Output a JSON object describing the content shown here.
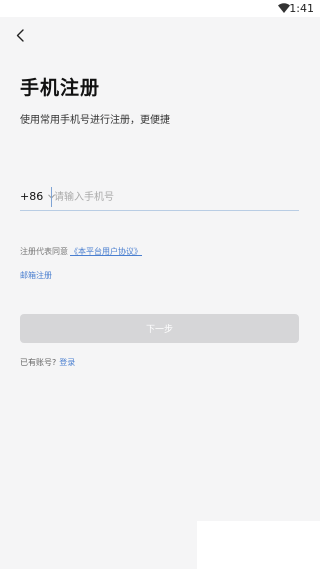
{
  "status_bar": {
    "time": "1:41"
  },
  "header": {
    "title": "手机注册",
    "subtitle": "使用常用手机号进行注册，更便捷"
  },
  "phone": {
    "country_code": "+86",
    "placeholder": "请输入手机号",
    "value": ""
  },
  "agreement": {
    "prefix": "注册代表同意",
    "link_label": "《本平台用户协议》"
  },
  "email_register_label": "邮箱注册",
  "next_button_label": "下一步",
  "login": {
    "prompt": "已有账号?",
    "link_label": "登录"
  },
  "colors": {
    "background": "#f5f5f6",
    "link": "#4a7fd0",
    "button_disabled": "#d6d6d8"
  }
}
